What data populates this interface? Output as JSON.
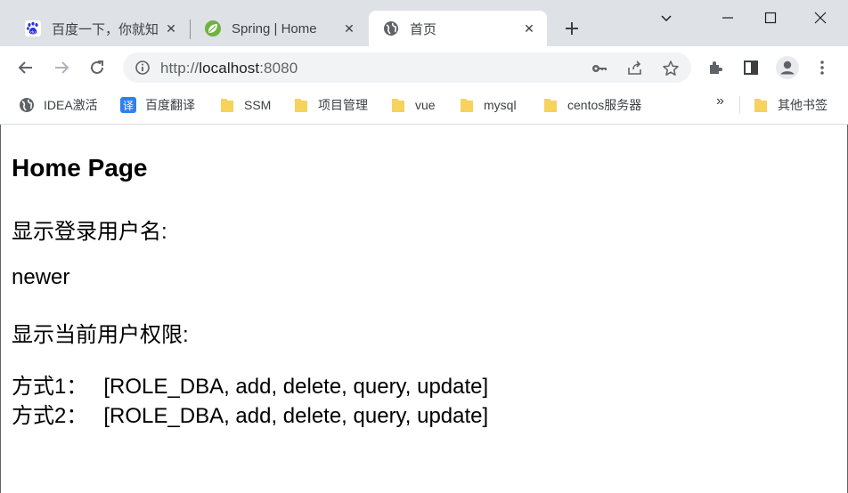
{
  "browser": {
    "tabs": [
      {
        "title": "百度一下，你就知",
        "favicon": "baidu-paw-icon",
        "active": false
      },
      {
        "title": "Spring | Home",
        "favicon": "spring-leaf-icon",
        "active": false
      },
      {
        "title": "首页",
        "favicon": "globe-icon",
        "active": true
      }
    ],
    "new_tab_icon": "plus-icon",
    "window_controls": [
      "chevron-down-icon",
      "minimize-icon",
      "maximize-icon",
      "close-icon"
    ],
    "address": {
      "scheme": "http://",
      "host": "localhost",
      "port": ":8080"
    },
    "bookmarks": [
      {
        "label": "IDEA激活",
        "icon": "globe-icon"
      },
      {
        "label": "百度翻译",
        "icon": "translate-icon",
        "icon_text": "译"
      },
      {
        "label": "SSM",
        "icon": "folder-icon"
      },
      {
        "label": "项目管理",
        "icon": "folder-icon"
      },
      {
        "label": "vue",
        "icon": "folder-icon"
      },
      {
        "label": "mysql",
        "icon": "folder-icon"
      },
      {
        "label": "centos服务器",
        "icon": "folder-icon"
      }
    ],
    "more_bookmarks": "»",
    "other_bookmarks": {
      "label": "其他书签",
      "icon": "folder-icon"
    },
    "colors": {
      "tab_strip": "#dee1e6",
      "omnibox": "#f1f3f4",
      "folder": "#f7d25c",
      "translate": "#2f80ed"
    }
  },
  "page": {
    "title": "Home Page",
    "username_label": "显示登录用户名:",
    "username": "newer",
    "authorities_label": "显示当前用户权限:",
    "method1_label": "方式1：",
    "method1_value": "[ROLE_DBA, add, delete, query, update]",
    "method2_label": "方式2：",
    "method2_value": "[ROLE_DBA, add, delete, query, update]"
  }
}
